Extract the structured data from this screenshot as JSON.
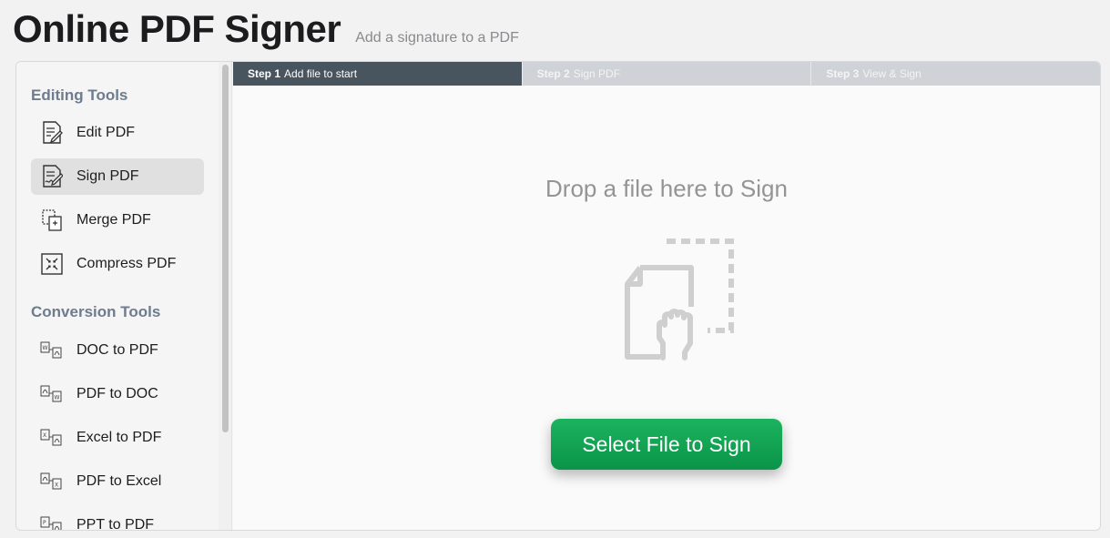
{
  "header": {
    "title": "Online PDF Signer",
    "subtitle": "Add a signature to a PDF"
  },
  "sidebar": {
    "editing_title": "Editing Tools",
    "editing_items": [
      {
        "label": "Edit PDF",
        "icon": "edit-pdf-icon"
      },
      {
        "label": "Sign PDF",
        "icon": "sign-pdf-icon",
        "active": true
      },
      {
        "label": "Merge PDF",
        "icon": "merge-pdf-icon"
      },
      {
        "label": "Compress PDF",
        "icon": "compress-pdf-icon"
      }
    ],
    "conversion_title": "Conversion Tools",
    "conversion_items": [
      {
        "label": "DOC to PDF",
        "icon": "doc-to-pdf-icon"
      },
      {
        "label": "PDF to DOC",
        "icon": "pdf-to-doc-icon"
      },
      {
        "label": "Excel to PDF",
        "icon": "excel-to-pdf-icon"
      },
      {
        "label": "PDF to Excel",
        "icon": "pdf-to-excel-icon"
      },
      {
        "label": "PPT to PDF",
        "icon": "ppt-to-pdf-icon"
      }
    ]
  },
  "steps": [
    {
      "num": "Step 1",
      "label": "Add file to start",
      "active": true
    },
    {
      "num": "Step 2",
      "label": "Sign PDF"
    },
    {
      "num": "Step 3",
      "label": "View & Sign"
    }
  ],
  "dropzone": {
    "text": "Drop a file here to Sign",
    "icon": "file-drop-hand-icon"
  },
  "select_button": {
    "label": "Select File to Sign"
  },
  "colors": {
    "button": "#0fa552",
    "active_step": "#48555e",
    "section_title": "#6d7c8e"
  }
}
